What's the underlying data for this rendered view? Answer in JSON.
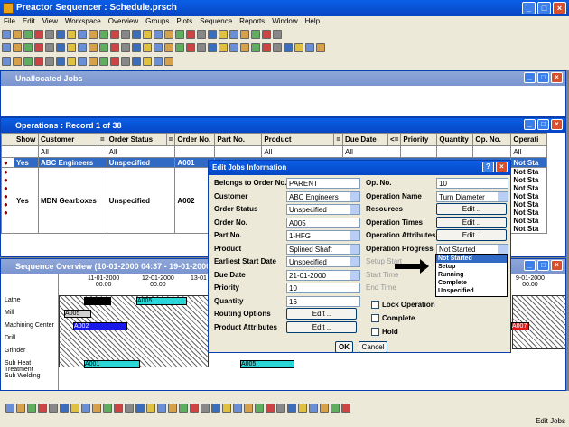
{
  "app": {
    "title": "Preactor Sequencer : Schedule.prsch"
  },
  "menu": [
    "File",
    "Edit",
    "View",
    "Workspace",
    "Overview",
    "Groups",
    "Plots",
    "Sequence",
    "Reports",
    "Window",
    "Help"
  ],
  "unalloc": {
    "title": "Unallocated Jobs"
  },
  "ops": {
    "title": "Operations : Record 1 of 38",
    "headers": [
      "Show",
      "Customer",
      "=",
      "Order Status",
      "=",
      "Order No.",
      "Part No.",
      "Product",
      "=",
      "Due Date",
      "<=",
      "Priority",
      "Quantity",
      "Op. No.",
      "Operati"
    ],
    "filters": {
      "customer": "All",
      "status": "All",
      "product": "All",
      "due": "All",
      "op": "All"
    },
    "rows": [
      {
        "show": "Yes",
        "customer": "ABC Engineers",
        "status": "Unspecified",
        "order": "A001",
        "opstat": "Not Sta"
      },
      {
        "show": "Yes",
        "customer": "MDN Gearboxes",
        "status": "Unspecified",
        "order": "A002",
        "opstat": "Not Sta"
      }
    ],
    "extra_status": [
      "Not Sta",
      "Not Sta",
      "Not Sta",
      "Not Sta",
      "Not Sta",
      "Not Sta",
      "Not Sta"
    ]
  },
  "seq": {
    "title": "Sequence Overview   (10-01-2000 04:37 - 19-01-2000",
    "dates": [
      {
        "d": "11-01-2000",
        "t": "00:00"
      },
      {
        "d": "12-01-2000",
        "t": "00:00"
      },
      {
        "d": "13-01"
      },
      {
        "d": "9-01-2000",
        "t": "00:00"
      }
    ],
    "resources": [
      "Lathe",
      "Mill",
      "Machining Center",
      "Drill",
      "Grinder",
      "Sub Heat Treatment",
      "Sub Welding"
    ],
    "bars": [
      "A005",
      "A002",
      "A005",
      "A004",
      "A001",
      "A005",
      "A007",
      "A002",
      "A007"
    ]
  },
  "dialog": {
    "title": "Edit Jobs Information",
    "left": [
      {
        "label": "Belongs to Order No.",
        "value": "PARENT"
      },
      {
        "label": "Customer",
        "value": "ABC Engineers"
      },
      {
        "label": "Order Status",
        "value": "Unspecified"
      },
      {
        "label": "Order No.",
        "value": "A005"
      },
      {
        "label": "Part No.",
        "value": "1-HFG"
      },
      {
        "label": "Product",
        "value": "Splined Shaft"
      },
      {
        "label": "Earliest Start Date",
        "value": "Unspecified"
      },
      {
        "label": "Due Date",
        "value": "21-01-2000"
      },
      {
        "label": "Priority",
        "value": "10"
      },
      {
        "label": "Quantity",
        "value": "16"
      },
      {
        "label": "Routing Options",
        "value": "Edit .."
      },
      {
        "label": "Product Attributes",
        "value": "Edit .."
      }
    ],
    "right": [
      {
        "label": "Op. No.",
        "value": "10"
      },
      {
        "label": "Operation Name",
        "value": "Turn Diameter"
      },
      {
        "label": "Resources",
        "value": "Edit .."
      },
      {
        "label": "Operation Times",
        "value": "Edit .."
      },
      {
        "label": "Operation Attributes",
        "value": "Edit .."
      },
      {
        "label": "Operation Progress",
        "value": "Not Started"
      },
      {
        "label": "Setup Start"
      },
      {
        "label": "Start Time"
      },
      {
        "label": "End Time"
      }
    ],
    "checks": [
      "Lock Operation",
      "Complete",
      "Hold"
    ],
    "ok": "OK",
    "cancel": "Cancel",
    "progress_options": [
      "Not Started",
      "Setup",
      "Running",
      "Complete",
      "Unspecified"
    ]
  },
  "status": {
    "text": "Edit Jobs"
  }
}
